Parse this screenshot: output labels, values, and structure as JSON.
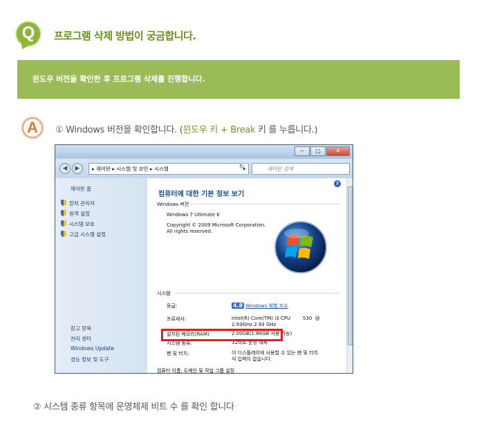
{
  "question": {
    "badge": "Q",
    "title": "프로그램 삭제 방법이 궁금합니다."
  },
  "answer_bar": {
    "text": "윈도우 버전을 확인한 후 프로그램 삭제를 진행합니다."
  },
  "answer": {
    "badge": "A",
    "step1_prefix": "① Windows 버전을 확인합니다.  (",
    "step1_highlight": "윈도우 키 + Break",
    "step1_suffix": " 키 를 누릅니다.)",
    "step2": "② 시스템 종류 항목에 운영체제 비트 수 를 확인 합니다"
  },
  "window": {
    "buttons": {
      "minimize": "─",
      "maximize": "□",
      "close": "✕"
    },
    "nav": {
      "back": "◀",
      "forward": "▶"
    },
    "address": "▸ 제어판 ▸ 시스템 및 보안 ▸ 시스템",
    "address_dropdown": "▾",
    "refresh": "↻",
    "search_placeholder": "제어판 검색",
    "left_pane": {
      "home": "제어판 홈",
      "tasks": [
        "장치 관리자",
        "원격 설정",
        "시스템 보호",
        "고급 시스템 설정"
      ],
      "see_also_title": "참고 항목",
      "see_also": [
        "관리 센터",
        "Windows Update",
        "성능 정보 및 도구"
      ]
    },
    "main": {
      "help": "?",
      "title": "컴퓨터에 대한 기본 정보 보기",
      "edition_section": "Windows 버전",
      "edition": "Windows 7 Ultimate K",
      "copyright": "Copyright © 2009 Microsoft Corporation.",
      "rights": "All rights reserved.",
      "system_section": "시스템",
      "rows": [
        {
          "key": "등급:",
          "score": "4.8",
          "value": "Windows 체험 지수"
        },
        {
          "key": "프로세서:",
          "value": "Intel(R) Core(TM) i3 CPU        530  @",
          "value2": "2.93GHz   2.93 GHz"
        },
        {
          "key": "설치된 메모리(RAM):",
          "value": "2.00GB(1.86GB 사용 가능)"
        },
        {
          "key": "시스템 종류:",
          "value": "32비트 운영 체제"
        },
        {
          "key": "펜 및 터치:",
          "value": "이 디스플레이에 사용할 수 있는 펜 및 터치",
          "value2": "식 입력이 없습니다."
        }
      ],
      "next_section": "컴퓨터 이름, 도메인 및 작업 그룹 설정"
    }
  }
}
